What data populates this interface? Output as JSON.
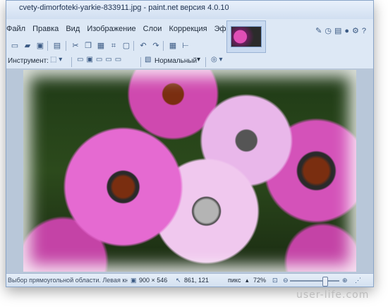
{
  "window": {
    "title": "cvety-dimorfoteki-yarkie-833911.jpg - paint.net версия 4.0.10"
  },
  "menu": {
    "items": [
      "Файл",
      "Правка",
      "Вид",
      "Изображение",
      "Слои",
      "Коррекция",
      "Эффекты"
    ]
  },
  "toolbar": {
    "tool_label": "Инструмент:",
    "blend_mode": "Нормальный"
  },
  "status": {
    "hint": "Выбор прямоугольной области. Левая кнопка - выделение обл...",
    "image_size": "900 × 546",
    "cursor_pos": "861, 121",
    "units": "пикс",
    "zoom": "72%",
    "zoom_fraction": 0.72
  },
  "watermark": "user-life.com",
  "colors": {
    "accent": "#3b5a84",
    "flower_pink": "#e56ad1"
  }
}
